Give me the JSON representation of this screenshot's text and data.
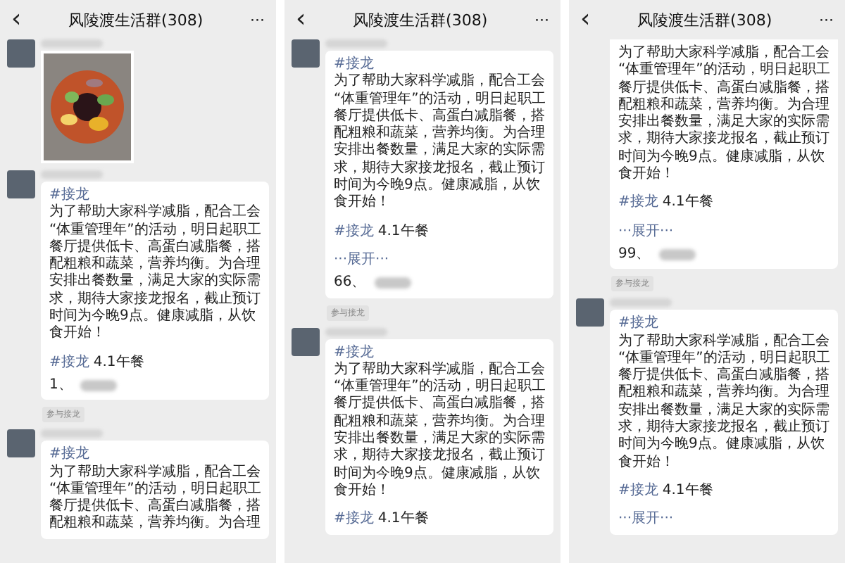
{
  "panels": [
    {
      "title": "风陵渡生活群(308)",
      "back": "‹",
      "more": "···",
      "messages": [
        {
          "kind": "image",
          "avatar": true
        },
        {
          "kind": "solitaire",
          "avatar": true,
          "tag": "#接龙",
          "lines": [
            "为了帮助大家科学减脂，配合工会",
            "“体重管理年”的活动，明日起职工",
            "餐厅提供低卡、高蛋白减脂餐，搭",
            "配粗粮和蔬菜，营养均衡。为合理",
            "安排出餐数量，满足大家的实际需",
            "求，期待大家接龙报名，截止预订",
            "时间为今晚9点。健康减脂，从饮",
            "食开始！"
          ],
          "topic": {
            "tag": "#接龙",
            "text": "4.1午餐"
          },
          "entry": "1、"
        },
        {
          "kind": "notice",
          "text": "参与接龙"
        },
        {
          "kind": "solitaire",
          "avatar": true,
          "tag": "#接龙",
          "lines": [
            "为了帮助大家科学减脂，配合工会",
            "“体重管理年”的活动，明日起职工",
            "餐厅提供低卡、高蛋白减脂餐，搭",
            "配粗粮和蔬菜，营养均衡。为合理"
          ]
        }
      ]
    },
    {
      "title": "风陵渡生活群(308)",
      "back": "‹",
      "more": "···",
      "messages": [
        {
          "kind": "solitaire",
          "avatar": true,
          "tag": "#接龙",
          "lines": [
            "为了帮助大家科学减脂，配合工会",
            "“体重管理年”的活动，明日起职工",
            "餐厅提供低卡、高蛋白减脂餐，搭",
            "配粗粮和蔬菜，营养均衡。为合理",
            "安排出餐数量，满足大家的实际需",
            "求，期待大家接龙报名，截止预订",
            "时间为今晚9点。健康减脂，从饮",
            "食开始！"
          ],
          "topic": {
            "tag": "#接龙",
            "text": "4.1午餐"
          },
          "expand": "···展开···",
          "entry": "66、"
        },
        {
          "kind": "notice",
          "text": "参与接龙"
        },
        {
          "kind": "solitaire",
          "avatar": true,
          "tag": "#接龙",
          "lines": [
            "为了帮助大家科学减脂，配合工会",
            "“体重管理年”的活动，明日起职工",
            "餐厅提供低卡、高蛋白减脂餐，搭",
            "配粗粮和蔬菜，营养均衡。为合理",
            "安排出餐数量，满足大家的实际需",
            "求，期待大家接龙报名，截止预订",
            "时间为今晚9点。健康减脂，从饮",
            "食开始！"
          ],
          "topic": {
            "tag": "#接龙",
            "text": "4.1午餐"
          }
        }
      ]
    },
    {
      "title": "风陵渡生活群(308)",
      "back": "‹",
      "more": "···",
      "messages": [
        {
          "kind": "solitaire",
          "avatar": false,
          "lines": [
            "为了帮助大家科学减脂，配合工会",
            "“体重管理年”的活动，明日起职工",
            "餐厅提供低卡、高蛋白减脂餐，搭",
            "配粗粮和蔬菜，营养均衡。为合理",
            "安排出餐数量，满足大家的实际需",
            "求，期待大家接龙报名，截止预订",
            "时间为今晚9点。健康减脂，从饮",
            "食开始！"
          ],
          "topic": {
            "tag": "#接龙",
            "text": "4.1午餐"
          },
          "expand": "···展开···",
          "entry": "99、"
        },
        {
          "kind": "notice",
          "text": "参与接龙"
        },
        {
          "kind": "solitaire",
          "avatar": true,
          "tag": "#接龙",
          "lines": [
            "为了帮助大家科学减脂，配合工会",
            "“体重管理年”的活动，明日起职工",
            "餐厅提供低卡、高蛋白减脂餐，搭",
            "配粗粮和蔬菜，营养均衡。为合理",
            "安排出餐数量，满足大家的实际需",
            "求，期待大家接龙报名，截止预订",
            "时间为今晚9点。健康减脂，从饮",
            "食开始！"
          ],
          "topic": {
            "tag": "#接龙",
            "text": "4.1午餐"
          },
          "expand": "···展开···"
        }
      ]
    }
  ]
}
